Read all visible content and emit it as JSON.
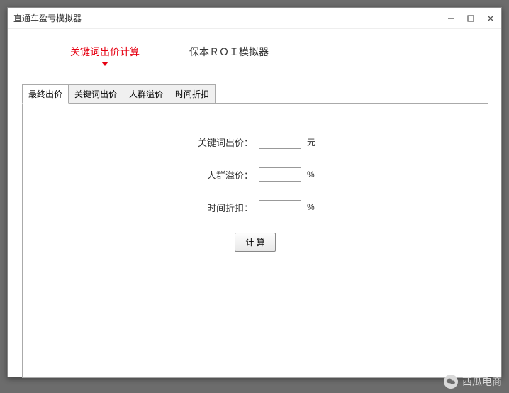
{
  "window": {
    "title": "直通车盈亏模拟器"
  },
  "topnav": {
    "items": [
      {
        "label": "关键词出价计算",
        "active": true
      },
      {
        "label": "保本ＲＯＩ模拟器",
        "active": false
      }
    ]
  },
  "tabs": {
    "items": [
      {
        "label": "最终出价",
        "active": true
      },
      {
        "label": "关键词出价",
        "active": false
      },
      {
        "label": "人群溢价",
        "active": false
      },
      {
        "label": "时间折扣",
        "active": false
      }
    ]
  },
  "form": {
    "keyword_bid": {
      "label": "关键词出价：",
      "value": "",
      "unit": "元"
    },
    "crowd_premium": {
      "label": "人群溢价：",
      "value": "",
      "unit": "%"
    },
    "time_discount": {
      "label": "时间折扣：",
      "value": "",
      "unit": "%"
    },
    "calc_button": "计 算"
  },
  "watermark": {
    "text": "西瓜电商"
  }
}
